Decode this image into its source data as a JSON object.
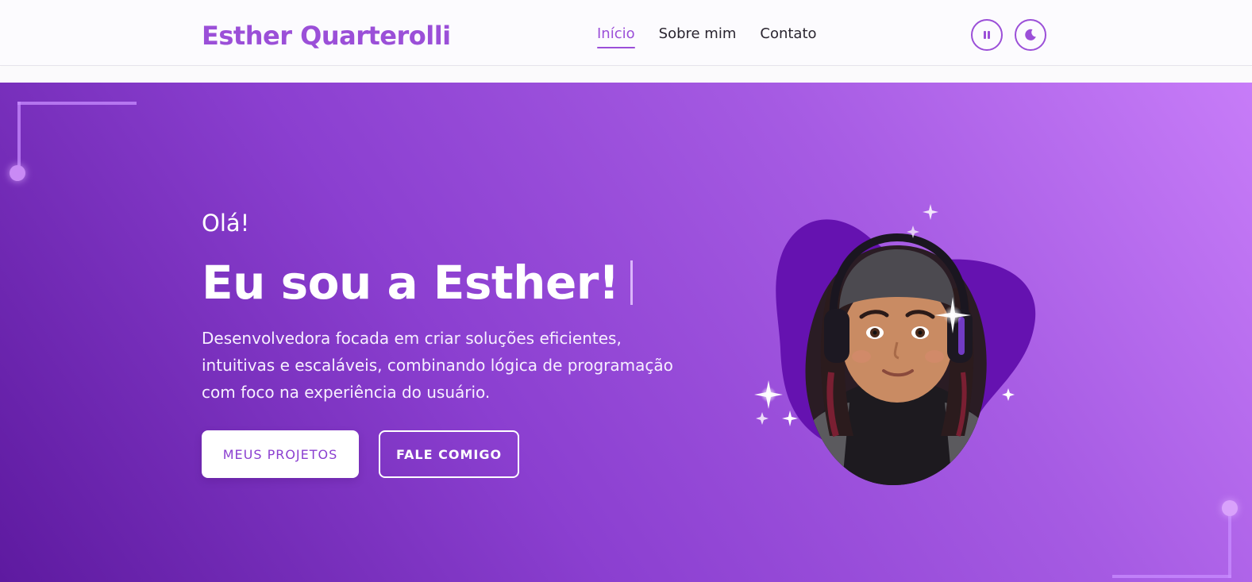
{
  "header": {
    "brand": "Esther Quarterolli",
    "nav": [
      {
        "label": "Início",
        "active": true
      },
      {
        "label": "Sobre mim",
        "active": false
      },
      {
        "label": "Contato",
        "active": false
      }
    ],
    "pause_icon": "pause-icon",
    "theme_icon": "moon-icon"
  },
  "hero": {
    "greeting": "Olá!",
    "headline": "Eu sou a Esther!",
    "description": "Desenvolvedora focada em criar soluções eficientes, intuitivas e escaláveis, combinando lógica de programação com foco na experiência do usuário.",
    "primary_button": "MEUS PROJETOS",
    "secondary_button": "FALE COMIGO"
  },
  "colors": {
    "accent": "#9b4fd8",
    "hero_start": "#5e1aa0",
    "hero_end": "#c77cf8",
    "blob": "#6512b0"
  }
}
